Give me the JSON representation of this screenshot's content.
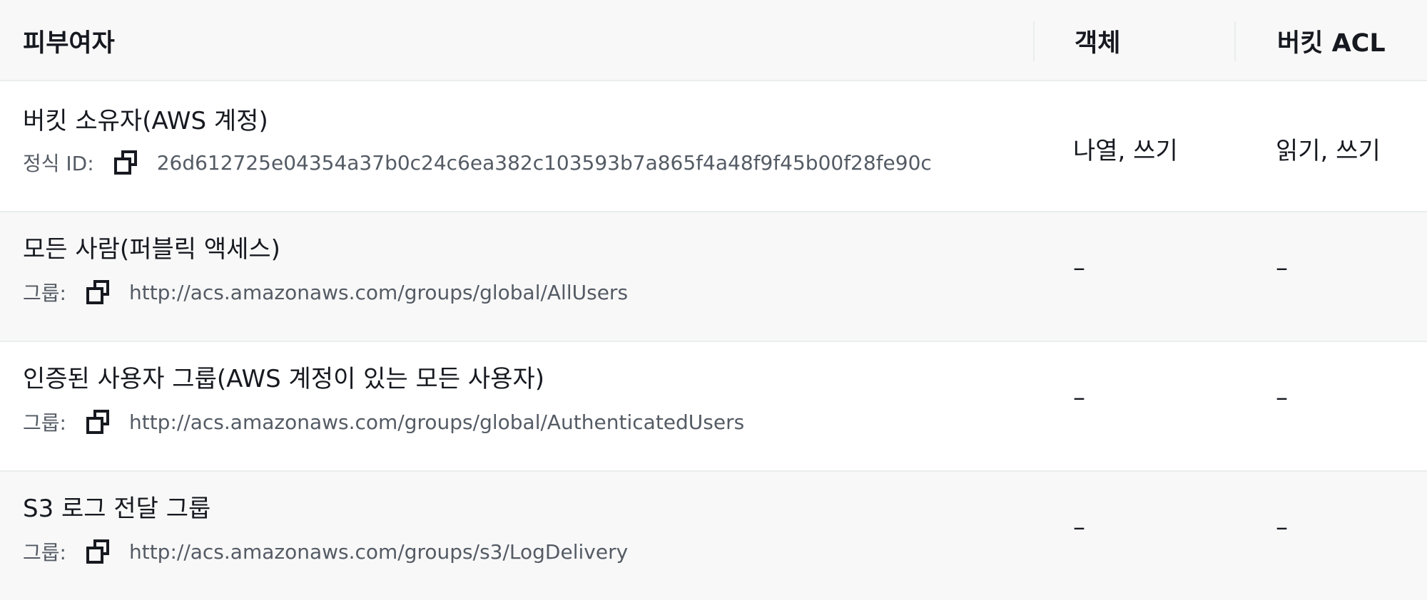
{
  "table": {
    "headers": {
      "grantee": "피부여자",
      "object": "객체",
      "bucket_acl": "버킷 ACL"
    },
    "rows": [
      {
        "grantee_name": "버킷 소유자(AWS 계정)",
        "id_label": "정식 ID:",
        "id_value": "26d612725e04354a37b0c24c6ea382c103593b7a865f4a48f9f45b00f28fe90c",
        "object": "나열, 쓰기",
        "bucket_acl": "읽기, 쓰기",
        "icon": "copy-icon"
      },
      {
        "grantee_name": "모든 사람(퍼블릭 액세스)",
        "id_label": "그룹:",
        "id_value": "http://acs.amazonaws.com/groups/global/AllUsers",
        "object": "–",
        "bucket_acl": "–",
        "icon": "copy-icon"
      },
      {
        "grantee_name": "인증된 사용자 그룹(AWS 계정이 있는 모든 사용자)",
        "id_label": "그룹:",
        "id_value": "http://acs.amazonaws.com/groups/global/AuthenticatedUsers",
        "object": "–",
        "bucket_acl": "–",
        "icon": "copy-icon"
      },
      {
        "grantee_name": "S3 로그 전달 그룹",
        "id_label": "그룹:",
        "id_value": "http://acs.amazonaws.com/groups/s3/LogDelivery",
        "object": "–",
        "bucket_acl": "–",
        "icon": "copy-icon"
      }
    ]
  }
}
